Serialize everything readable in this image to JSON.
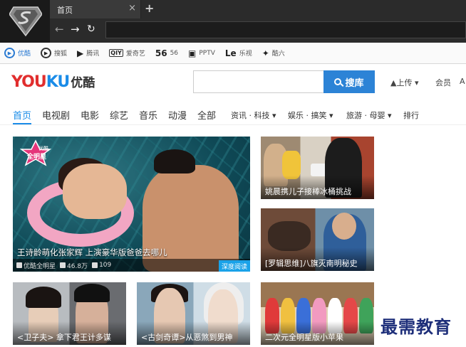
{
  "browser": {
    "tab_title": "首页",
    "tab_close": "×",
    "new_tab": "+",
    "nav_back": "←",
    "nav_forward": "→",
    "nav_reload": "↻"
  },
  "bookmarks": [
    {
      "icon": "▶",
      "label": "优酷"
    },
    {
      "icon": "▶",
      "label": "搜狐"
    },
    {
      "icon": "▶",
      "label": "腾讯"
    },
    {
      "icon": "QIY",
      "label": "爱奇艺"
    },
    {
      "icon": "56",
      "label": "56"
    },
    {
      "icon": "▣",
      "label": "PPTV"
    },
    {
      "icon": "Le",
      "label": "乐视"
    },
    {
      "icon": "✦",
      "label": "酷六"
    }
  ],
  "header": {
    "logo_part1": "YOU",
    "logo_part2": "KU",
    "logo_cn": "优酷",
    "search_placeholder": "",
    "search_button": "搜库",
    "upload": "上传",
    "member": "会员",
    "more": "A"
  },
  "channels": [
    "首页",
    "电视剧",
    "电影",
    "综艺",
    "音乐",
    "动漫",
    "全部",
    "资讯 · 科技",
    "娱乐 · 搞笑",
    "旅游 · 母婴",
    "排行"
  ],
  "hero": {
    "badge_top": "优酷",
    "badge_bottom": "全明星",
    "title": "王诗龄萌化张家辉 上演豪华版爸爸去哪儿",
    "channel": "优酷全明星",
    "views": "46.8万",
    "comments": "109",
    "deep_read": "深度阅读"
  },
  "cards": [
    {
      "caption": "姚晨携儿子接棒冰桶挑战"
    },
    {
      "caption": "[罗辑思维]八旗灭南明秘史"
    },
    {
      "caption": "<卫子夫> 拿下君王计多谋"
    },
    {
      "caption": "<古剑奇谭>从恶煞到男神"
    },
    {
      "caption": "二次元全明星版小苹果"
    }
  ],
  "watermark": "最需教育",
  "colors": {
    "accent_blue": "#2c83d6",
    "logo_red": "#e12e2e",
    "logo_blue": "#1a8ce8"
  }
}
